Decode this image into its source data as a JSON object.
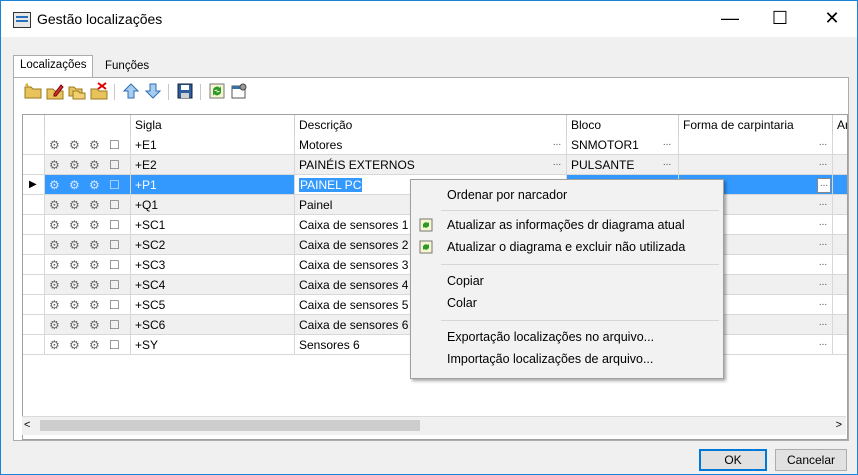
{
  "window": {
    "title": "Gestão localizações",
    "minimize": "—",
    "maximize": "☐",
    "close": "✕"
  },
  "tabs": [
    {
      "label": "Localizações"
    },
    {
      "label": "Funções"
    }
  ],
  "toolbar": {
    "buttons": [
      {
        "icon": "new-folder-icon"
      },
      {
        "icon": "edit-icon"
      },
      {
        "icon": "copy-icon"
      },
      {
        "icon": "delete-icon"
      },
      {
        "icon": "arrow-up-icon"
      },
      {
        "icon": "arrow-down-icon"
      },
      {
        "icon": "save-icon"
      },
      {
        "icon": "refresh-icon"
      },
      {
        "icon": "properties-icon"
      }
    ]
  },
  "grid": {
    "columns": [
      "",
      "Sigla",
      "Descrição",
      "Bloco",
      "Forma de carpintaria",
      "Artigo"
    ],
    "rows": [
      {
        "sigla": "+E1",
        "descricao": "Motores",
        "bloco": "SNMOTOR1",
        "forma": ""
      },
      {
        "sigla": "+E2",
        "descricao": "PAINÉIS EXTERNOS",
        "bloco": "PULSANTE",
        "forma": ""
      },
      {
        "sigla": "+P1",
        "descricao": "PAINEL PC",
        "bloco": "",
        "forma": ""
      },
      {
        "sigla": "+Q1",
        "descricao": "Painel",
        "bloco": "",
        "forma": ""
      },
      {
        "sigla": "+SC1",
        "descricao": "Caixa de sensores 1",
        "bloco": "",
        "forma": ""
      },
      {
        "sigla": "+SC2",
        "descricao": "Caixa de sensores 2",
        "bloco": "",
        "forma": ""
      },
      {
        "sigla": "+SC3",
        "descricao": "Caixa de sensores 3",
        "bloco": "",
        "forma": ""
      },
      {
        "sigla": "+SC4",
        "descricao": "Caixa de sensores 4",
        "bloco": "",
        "forma": ""
      },
      {
        "sigla": "+SC5",
        "descricao": "Caixa de sensores 5",
        "bloco": "",
        "forma": ""
      },
      {
        "sigla": "+SC6",
        "descricao": "Caixa de sensores 6",
        "bloco": "",
        "forma": ""
      },
      {
        "sigla": "+SY",
        "descricao": "Sensores 6",
        "bloco": "",
        "forma": ""
      }
    ],
    "selected_row_index": 2,
    "ellipsis": "...",
    "scroll_left": "<",
    "scroll_right": ">"
  },
  "context_menu": {
    "items": [
      {
        "label": "Ordenar por narcador",
        "icon": ""
      },
      {
        "label": "Atualizar as informações dr diagrama atual",
        "icon": "refresh-icon"
      },
      {
        "label": "Atualizar o diagrama e excluir não utilizada",
        "icon": "refresh-icon"
      },
      {
        "label": "Copiar",
        "icon": ""
      },
      {
        "label": "Colar",
        "icon": ""
      },
      {
        "label": "Exportação localizações no arquivo...",
        "icon": ""
      },
      {
        "label": "Importação localizações de arquivo...",
        "icon": ""
      }
    ]
  },
  "buttons": {
    "ok": "OK",
    "cancel": "Cancelar"
  },
  "colors": {
    "selection": "#3399ff",
    "accent": "#0078d7",
    "row_alt": "#f0f0f0"
  }
}
